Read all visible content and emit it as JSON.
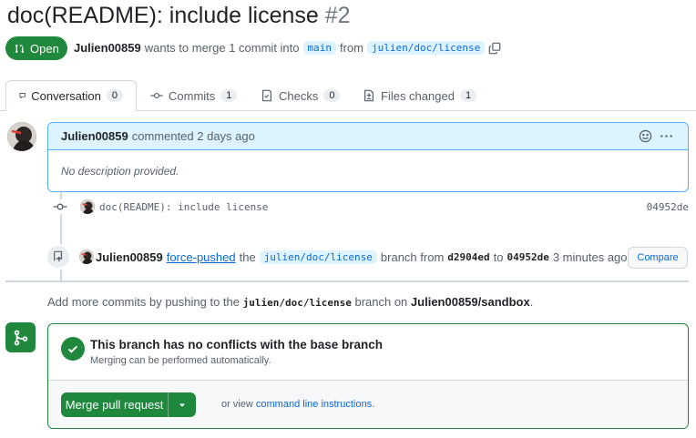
{
  "pr": {
    "title": "doc(README): include license",
    "number": "#2",
    "state": "Open",
    "author": "Julien00859",
    "meta_text": "wants to merge 1 commit into",
    "base_branch": "main",
    "from_text": "from",
    "head_branch": "julien/doc/license"
  },
  "tabs": [
    {
      "label": "Conversation",
      "count": "0"
    },
    {
      "label": "Commits",
      "count": "1"
    },
    {
      "label": "Checks",
      "count": "0"
    },
    {
      "label": "Files changed",
      "count": "1"
    }
  ],
  "comment": {
    "author": "Julien00859",
    "action": "commented 2 days ago",
    "body": "No description provided."
  },
  "commit": {
    "message": "doc(README): include license",
    "sha": "04952de"
  },
  "force_push": {
    "author": "Julien00859",
    "link": "force-pushed",
    "the": "the",
    "branch": "julien/doc/license",
    "branch_from": "branch from",
    "old_sha": "d2904ed",
    "to": "to",
    "new_sha": "04952de",
    "time": "3 minutes ago",
    "compare_label": "Compare"
  },
  "add_more": {
    "prefix": "Add more commits by pushing to the",
    "branch": "julien/doc/license",
    "middle": "branch on",
    "repo": "Julien00859/sandbox",
    "suffix": "."
  },
  "merge": {
    "title": "This branch has no conflicts with the base branch",
    "subtitle": "Merging can be performed automatically.",
    "button": "Merge pull request",
    "alt_prefix": "or view",
    "alt_link": "command line instructions",
    "alt_suffix": "."
  },
  "colors": {
    "green": "#1f883d",
    "blue": "#0969da",
    "comment_bg": "#ddf4ff"
  }
}
